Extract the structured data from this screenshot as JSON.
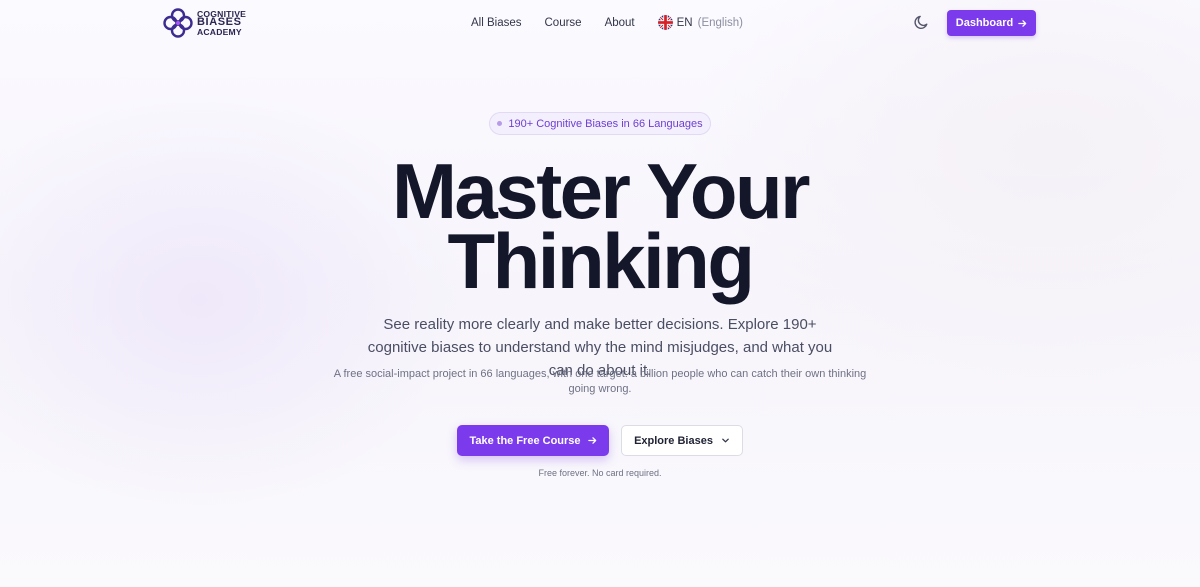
{
  "logo": {
    "line1": "COGNITIVE",
    "line2": "BIASES",
    "line3": "ACADEMY",
    "icon": "cognitive-biases-academy-logo"
  },
  "nav": {
    "items": [
      {
        "label": "All Biases"
      },
      {
        "label": "Course"
      },
      {
        "label": "About"
      }
    ],
    "language": {
      "code": "EN",
      "name": "(English)",
      "icon": "uk-flag-icon"
    }
  },
  "header": {
    "theme_icon": "moon-icon",
    "dashboard_label": "Dashboard"
  },
  "hero": {
    "badge": "190+ Cognitive Biases in 66 Languages",
    "headline_line1": "Master Your",
    "headline_line2": "Thinking",
    "subtitle": "See reality more clearly and make better decisions. Explore 190+ cognitive biases to understand why the mind misjudges, and what you can do about it.",
    "tagline": "A free social-impact project in 66 languages, with one target: a billion people who can catch their own thinking going wrong.",
    "primary_cta": "Take the Free Course",
    "secondary_cta": "Explore Biases",
    "note": "Free forever. No card required."
  },
  "colors": {
    "accent": "#7c3aed",
    "headline": "#141729",
    "badge_text": "#6d3fd1"
  }
}
